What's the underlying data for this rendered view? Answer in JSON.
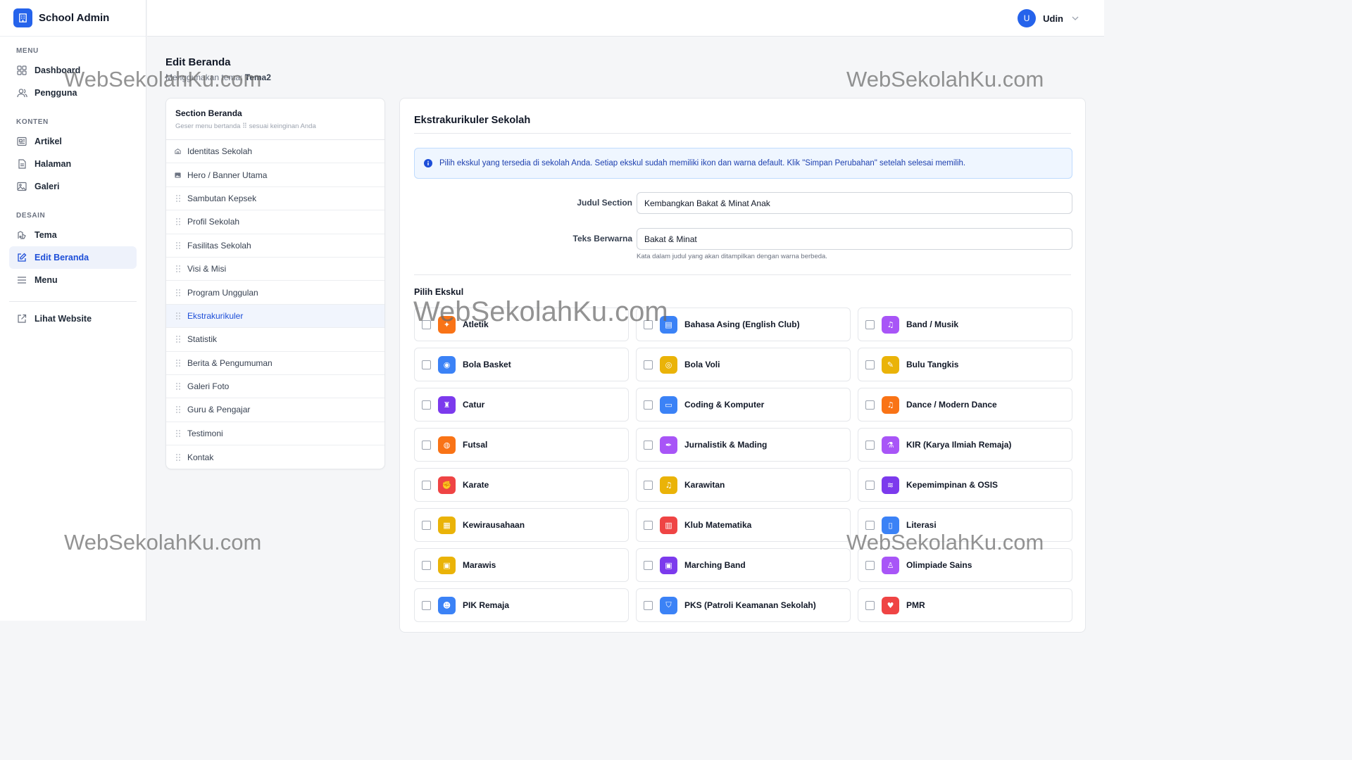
{
  "app": {
    "name": "School Admin"
  },
  "user": {
    "initial": "U",
    "name": "Udin"
  },
  "sidebar": {
    "groups": [
      {
        "label": "MENU",
        "items": [
          {
            "label": "Dashboard",
            "icon": "grid-icon"
          },
          {
            "label": "Pengguna",
            "icon": "users-icon"
          }
        ]
      },
      {
        "label": "KONTEN",
        "items": [
          {
            "label": "Artikel",
            "icon": "newspaper-icon"
          },
          {
            "label": "Halaman",
            "icon": "file-icon"
          },
          {
            "label": "Galeri",
            "icon": "image-icon"
          }
        ]
      },
      {
        "label": "DESAIN",
        "items": [
          {
            "label": "Tema",
            "icon": "palette-icon"
          },
          {
            "label": "Edit Beranda",
            "icon": "edit-icon",
            "active": true
          },
          {
            "label": "Menu",
            "icon": "menu-icon"
          }
        ]
      }
    ],
    "external": {
      "label": "Lihat Website",
      "icon": "external-link-icon"
    }
  },
  "page": {
    "title": "Edit Beranda",
    "subtitle_prefix": "Menggunakan tema: ",
    "theme": "Tema2"
  },
  "sections": {
    "title": "Section Beranda",
    "desc": "Geser menu bertanda ⠿ sesuai keinginan Anda",
    "items": [
      {
        "label": "Identitas Sekolah",
        "icon": "id-card-icon"
      },
      {
        "label": "Hero / Banner Utama",
        "icon": "image-icon"
      },
      {
        "label": "Sambutan Kepsek",
        "icon": "grip-icon"
      },
      {
        "label": "Profil Sekolah",
        "icon": "grip-icon"
      },
      {
        "label": "Fasilitas Sekolah",
        "icon": "grip-icon"
      },
      {
        "label": "Visi & Misi",
        "icon": "grip-icon"
      },
      {
        "label": "Program Unggulan",
        "icon": "grip-icon"
      },
      {
        "label": "Ekstrakurikuler",
        "icon": "grip-icon",
        "active": true
      },
      {
        "label": "Statistik",
        "icon": "grip-icon"
      },
      {
        "label": "Berita & Pengumuman",
        "icon": "grip-icon"
      },
      {
        "label": "Galeri Foto",
        "icon": "grip-icon"
      },
      {
        "label": "Guru & Pengajar",
        "icon": "grip-icon"
      },
      {
        "label": "Testimoni",
        "icon": "grip-icon"
      },
      {
        "label": "Kontak",
        "icon": "grip-icon"
      }
    ]
  },
  "editor": {
    "title": "Ekstrakurikuler Sekolah",
    "info": "Pilih ekskul yang tersedia di sekolah Anda. Setiap ekskul sudah memiliki ikon dan warna default. Klik \"Simpan Perubahan\" setelah selesai memilih.",
    "judul_label": "Judul Section",
    "judul_value": "Kembangkan Bakat & Minat Anak",
    "teks_label": "Teks Berwarna",
    "teks_value": "Bakat & Minat",
    "teks_hint": "Kata dalam judul yang akan ditampilkan dengan warna berbeda.",
    "ekskul_title": "Pilih Ekskul",
    "ekskul": [
      {
        "label": "Atletik",
        "color": "#f97316",
        "icon": "running-icon"
      },
      {
        "label": "Bahasa Asing (English Club)",
        "color": "#3b82f6",
        "icon": "language-icon"
      },
      {
        "label": "Band / Musik",
        "color": "#a855f7",
        "icon": "music-icon"
      },
      {
        "label": "Bola Basket",
        "color": "#3b82f6",
        "icon": "basketball-icon"
      },
      {
        "label": "Bola Voli",
        "color": "#eab308",
        "icon": "volleyball-icon"
      },
      {
        "label": "Bulu Tangkis",
        "color": "#eab308",
        "icon": "shuttlecock-icon"
      },
      {
        "label": "Catur",
        "color": "#7c3aed",
        "icon": "chess-icon"
      },
      {
        "label": "Coding & Komputer",
        "color": "#3b82f6",
        "icon": "laptop-icon"
      },
      {
        "label": "Dance / Modern Dance",
        "color": "#f97316",
        "icon": "music-icon"
      },
      {
        "label": "Futsal",
        "color": "#f97316",
        "icon": "soccer-icon"
      },
      {
        "label": "Jurnalistik & Mading",
        "color": "#a855f7",
        "icon": "pen-icon"
      },
      {
        "label": "KIR (Karya Ilmiah Remaja)",
        "color": "#a855f7",
        "icon": "flask-icon"
      },
      {
        "label": "Karate",
        "color": "#ef4444",
        "icon": "fist-icon"
      },
      {
        "label": "Karawitan",
        "color": "#eab308",
        "icon": "music-icon"
      },
      {
        "label": "Kepemimpinan & OSIS",
        "color": "#7c3aed",
        "icon": "handshake-icon"
      },
      {
        "label": "Kewirausahaan",
        "color": "#eab308",
        "icon": "store-icon"
      },
      {
        "label": "Klub Matematika",
        "color": "#ef4444",
        "icon": "calculator-icon"
      },
      {
        "label": "Literasi",
        "color": "#3b82f6",
        "icon": "book-icon"
      },
      {
        "label": "Marawis",
        "color": "#eab308",
        "icon": "drum-icon"
      },
      {
        "label": "Marching Band",
        "color": "#7c3aed",
        "icon": "drum-icon"
      },
      {
        "label": "Olimpiade Sains",
        "color": "#a855f7",
        "icon": "microscope-icon"
      },
      {
        "label": "PIK Remaja",
        "color": "#3b82f6",
        "icon": "people-icon"
      },
      {
        "label": "PKS (Patroli Keamanan Sekolah)",
        "color": "#3b82f6",
        "icon": "shield-icon"
      },
      {
        "label": "PMR",
        "color": "#ef4444",
        "icon": "heart-icon"
      }
    ]
  },
  "watermark": "WebSekolahKu.com"
}
